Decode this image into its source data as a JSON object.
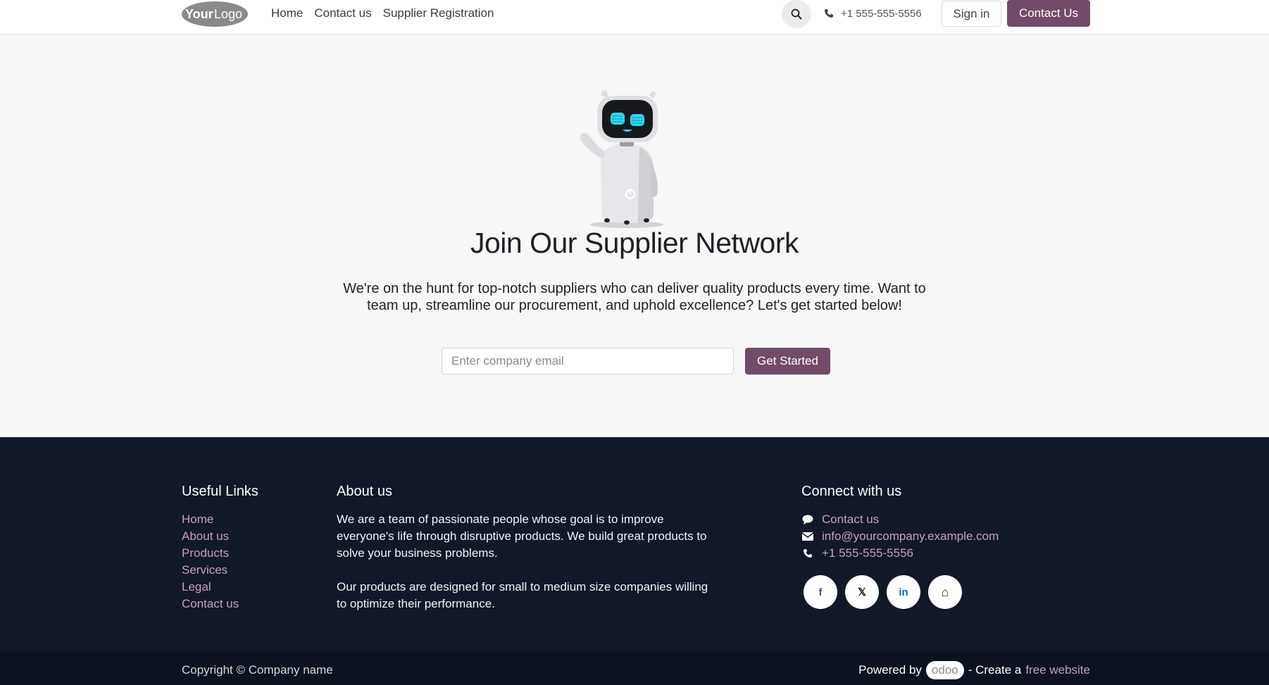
{
  "header": {
    "logo_text": "YourLogo",
    "nav": [
      {
        "label": "Home"
      },
      {
        "label": "Contact us"
      },
      {
        "label": "Supplier Registration"
      }
    ],
    "phone": "+1 555-555-5556",
    "sign_in": "Sign in",
    "contact_button": "Contact Us"
  },
  "hero": {
    "title": "Join Our Supplier Network",
    "text": "We're on the hunt for top-notch suppliers who can deliver quality products every time. Want to team up, streamline our procurement, and uphold excellence? Let's get started below!",
    "email_placeholder": "Enter company email",
    "email_value": "",
    "cta": "Get Started"
  },
  "footer": {
    "useful_links": {
      "heading": "Useful Links",
      "items": [
        "Home",
        "About us",
        "Products",
        "Services",
        "Legal",
        "Contact us"
      ]
    },
    "about": {
      "heading": "About us",
      "p1": "We are a team of passionate people whose goal is to improve everyone's life through disruptive products. We build great products to solve your business problems.",
      "p2": "Our products are designed for small to medium size companies willing to optimize their performance."
    },
    "connect": {
      "heading": "Connect with us",
      "contact": "Contact us",
      "email": "info@yourcompany.example.com",
      "phone": "+1 555-555-5556",
      "socials": [
        {
          "icon": "facebook-icon",
          "glyph": "f",
          "color": "#3b5998"
        },
        {
          "icon": "x-twitter-icon",
          "glyph": "𝕏",
          "color": "#111111"
        },
        {
          "icon": "linkedin-icon",
          "glyph": "in",
          "color": "#0a66c2"
        },
        {
          "icon": "home-icon",
          "glyph": "⌂",
          "color": "#333333"
        }
      ]
    },
    "copyright": "Copyright © Company name",
    "powered_by": "Powered by",
    "odoo": "odoo",
    "create_a": "- Create a",
    "free_website": "free website"
  },
  "colors": {
    "brand": "#714b67",
    "footer_bg": "#111827",
    "link": "#c79fc0"
  }
}
